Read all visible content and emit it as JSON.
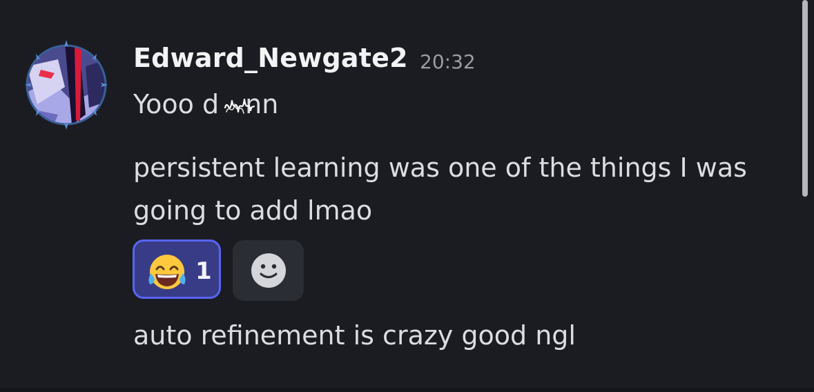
{
  "message": {
    "author": "Edward_Newgate2",
    "timestamp": "20:32",
    "lines": [
      "Yooo d  nn",
      "persistent learning was one of the things I was going to add lmao",
      "auto refinement is crazy good ngl"
    ]
  },
  "reactions": [
    {
      "emoji": "face-with-tears-of-joy",
      "count": "1",
      "selected": true
    }
  ],
  "add_reaction": {
    "icon": "smiley-add-reaction-icon"
  },
  "colors": {
    "background": "#1b1c21",
    "username": "#f2f3f5",
    "timestamp": "#9b9da4",
    "text": "#dbdee1",
    "reaction_border": "#5865f2",
    "reaction_bg": "#383c87",
    "add_reaction_bg": "#2b2d34"
  }
}
